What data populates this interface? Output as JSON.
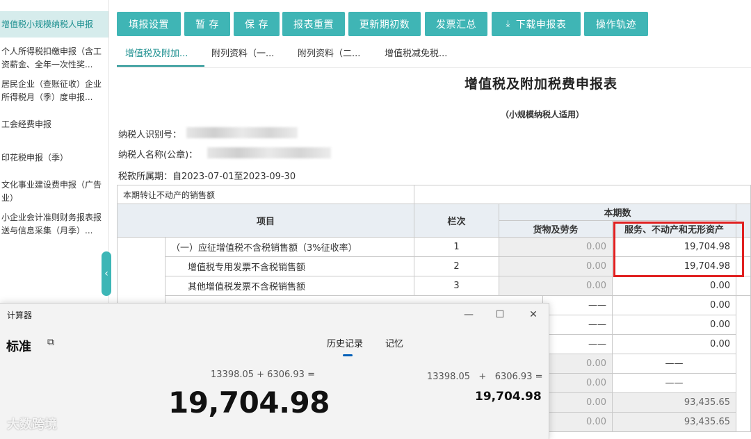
{
  "sidebar": {
    "items": [
      {
        "label": "增值税小规模纳税人申报"
      },
      {
        "label": "个人所得税扣缴申报（含工资薪金、全年一次性奖..."
      },
      {
        "label": "居民企业（查账征收）企业所得税月（季）度申报..."
      },
      {
        "label": "工会经费申报"
      },
      {
        "label": "印花税申报（季）"
      },
      {
        "label": "文化事业建设费申报（广告业）"
      },
      {
        "label": "小企业会计准则财务报表报送与信息采集（月季）..."
      }
    ],
    "collapse_icon": "chevron-left-icon",
    "collapse_glyph": "‹"
  },
  "toolbar": {
    "buttons": [
      {
        "label": "填报设置"
      },
      {
        "label": "暂 存"
      },
      {
        "label": "保 存"
      },
      {
        "label": "报表重置"
      },
      {
        "label": "更新期初数"
      },
      {
        "label": "发票汇总"
      },
      {
        "label": "下载申报表",
        "icon": "download-icon",
        "glyph": "⤓"
      },
      {
        "label": "操作轨迹"
      }
    ]
  },
  "tabs": [
    {
      "label": "增值税及附加..."
    },
    {
      "label": "附列资料（一..."
    },
    {
      "label": "附列资料（二..."
    },
    {
      "label": "增值税减免税..."
    }
  ],
  "form": {
    "title": "增值税及附加税费申报表",
    "subtitle": "（小规模纳税人适用）",
    "taxpayer_id_label": "纳税人识别号：",
    "taxpayer_name_label": "纳税人名称(公章)：",
    "period": "税款所属期：自2023-07-01至2023-09-30"
  },
  "table": {
    "top_note": "本期转让不动产的销售额",
    "headers": {
      "item": "项目",
      "column_no": "栏次",
      "current_period": "本期数",
      "goods_services": "货物及劳务",
      "services_intangibles": "服务、不动产和无形资产"
    },
    "rows": [
      {
        "item": "（一）应征增值税不含税销售额（3%征收率）",
        "no": "1",
        "goods": "0.00",
        "services": "19,704.98"
      },
      {
        "item": "增值税专用发票不含税销售额",
        "no": "2",
        "goods": "0.00",
        "services": "19,704.98"
      },
      {
        "item": "其他增值税发票不含税销售额",
        "no": "3",
        "goods": "0.00",
        "services": "0.00"
      },
      {
        "goods": "——",
        "services": "0.00"
      },
      {
        "goods": "——",
        "services": "0.00"
      },
      {
        "goods": "——",
        "services": "0.00"
      },
      {
        "goods": "0.00",
        "services": "——"
      },
      {
        "goods": "0.00",
        "services": "——"
      },
      {
        "goods": "0.00",
        "services": "93,435.65"
      },
      {
        "goods": "0.00",
        "services": "93,435.65"
      }
    ]
  },
  "calculator": {
    "title": "计算器",
    "mode": "标准",
    "keep_on_top_icon": "keep-on-top-icon",
    "keep_on_top_glyph": "⧉",
    "window_controls": {
      "minimize": "—",
      "maximize": "☐",
      "close": "✕"
    },
    "tabs": {
      "history": "历史记录",
      "memory": "记忆"
    },
    "expression": "13398.05 + 6306.93 =",
    "result": "19,704.98",
    "history": {
      "expression": "13398.05   +   6306.93 =",
      "result": "19,704.98"
    }
  },
  "watermark": "大数跨境"
}
